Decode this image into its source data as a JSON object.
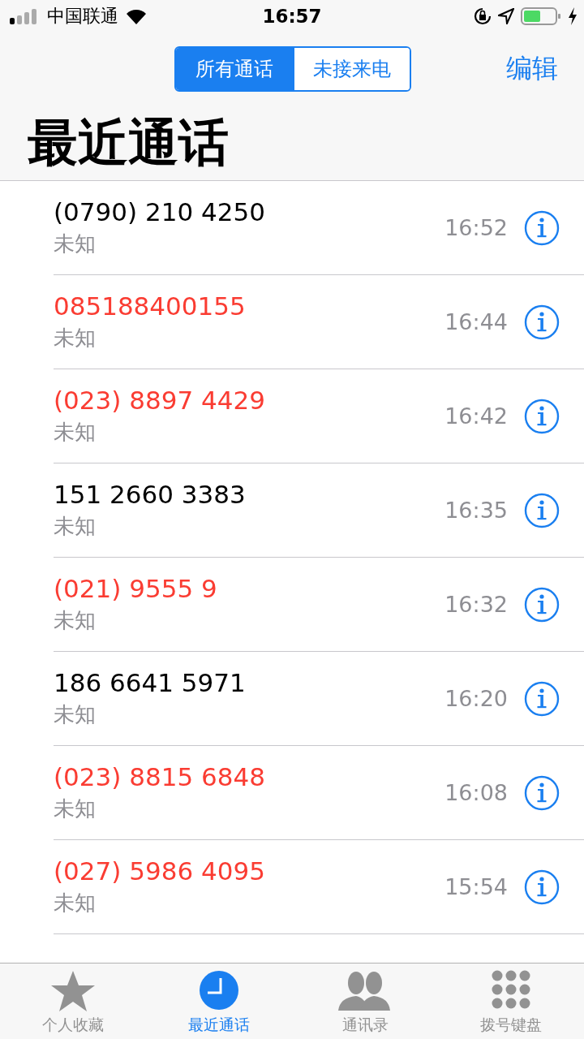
{
  "status_bar": {
    "carrier": "中国联通",
    "time": "16:57"
  },
  "segments": [
    {
      "label": "所有通话",
      "selected": true
    },
    {
      "label": "未接来电",
      "selected": false
    }
  ],
  "edit_button": "编辑",
  "title": "最近通话",
  "calls": [
    {
      "number": "(0790) 210 4250",
      "label": "未知",
      "time": "16:52",
      "missed": false
    },
    {
      "number": "085188400155",
      "label": "未知",
      "time": "16:44",
      "missed": true
    },
    {
      "number": "(023) 8897 4429",
      "label": "未知",
      "time": "16:42",
      "missed": true
    },
    {
      "number": "151 2660 3383",
      "label": "未知",
      "time": "16:35",
      "missed": false
    },
    {
      "number": "(021) 9555 9",
      "label": "未知",
      "time": "16:32",
      "missed": true
    },
    {
      "number": "186 6641 5971",
      "label": "未知",
      "time": "16:20",
      "missed": false
    },
    {
      "number": "(023) 8815 6848",
      "label": "未知",
      "time": "16:08",
      "missed": true
    },
    {
      "number": "(027) 5986 4095",
      "label": "未知",
      "time": "15:54",
      "missed": true
    }
  ],
  "tab_bar": [
    {
      "kind": "star",
      "label": "个人收藏",
      "selected": false
    },
    {
      "kind": "clock",
      "label": "最近通话",
      "selected": true
    },
    {
      "kind": "contacts",
      "label": "通讯录",
      "selected": false
    },
    {
      "kind": "keypad",
      "label": "拨号键盘",
      "selected": false
    }
  ]
}
